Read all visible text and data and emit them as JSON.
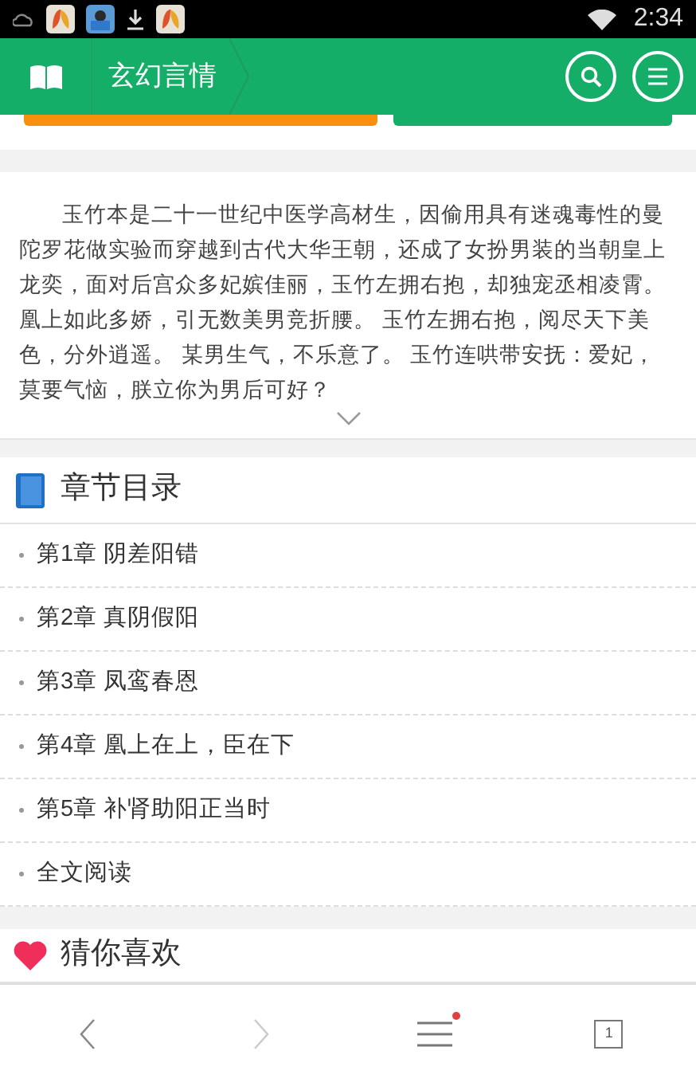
{
  "status_bar": {
    "time": "2:34"
  },
  "header": {
    "title": "玄幻言情"
  },
  "intro": {
    "paragraphs": [
      "玉竹本是二十一世纪中医学高材生，因偷用具有迷魂毒性的曼陀罗花做实验而穿越到古代大华王朝，还成了女扮男装的当朝皇上龙奕，面对后宫众多妃嫔佳丽，玉竹左拥右抱，却独宠丞相凌霄。",
      "凰上如此多娇，引无数美男竞折腰。 玉竹左拥右抱，阅尽天下美色，分外逍遥。 某男生气，不乐意了。 玉竹连哄带安抚：爱妃，莫要气恼，朕立你为男后可好？"
    ]
  },
  "toc": {
    "title": "章节目录",
    "items": [
      {
        "label": "第1章 阴差阳错"
      },
      {
        "label": "第2章 真阴假阳"
      },
      {
        "label": "第3章 凤鸾春恩"
      },
      {
        "label": "第4章 凰上在上，臣在下"
      },
      {
        "label": "第5章 补肾助阳正当时"
      },
      {
        "label": "全文阅读"
      }
    ]
  },
  "recommend": {
    "title": "猜你喜欢"
  },
  "bottom_nav": {
    "menu_badge": true,
    "tab_count": "1"
  }
}
